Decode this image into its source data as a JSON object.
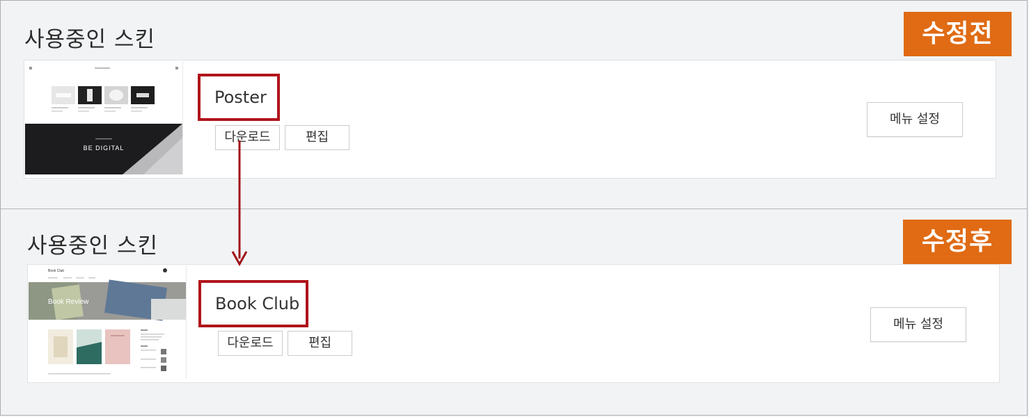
{
  "before": {
    "section_title": "사용중인 스킨",
    "badge": "수정전",
    "skin_name": "Poster",
    "download_label": "다운로드",
    "edit_label": "편집",
    "menu_settings_label": "메뉴 설정",
    "thumbnail_text": "BE DIGITAL"
  },
  "after": {
    "section_title": "사용중인 스킨",
    "badge": "수정후",
    "skin_name": "Book Club",
    "download_label": "다운로드",
    "edit_label": "편집",
    "menu_settings_label": "메뉴 설정",
    "thumbnail_title": "Book Club",
    "thumbnail_text": "Book Review"
  },
  "colors": {
    "badge": "#e06b14",
    "highlight": "#b0141b",
    "arrow": "#a01318"
  }
}
